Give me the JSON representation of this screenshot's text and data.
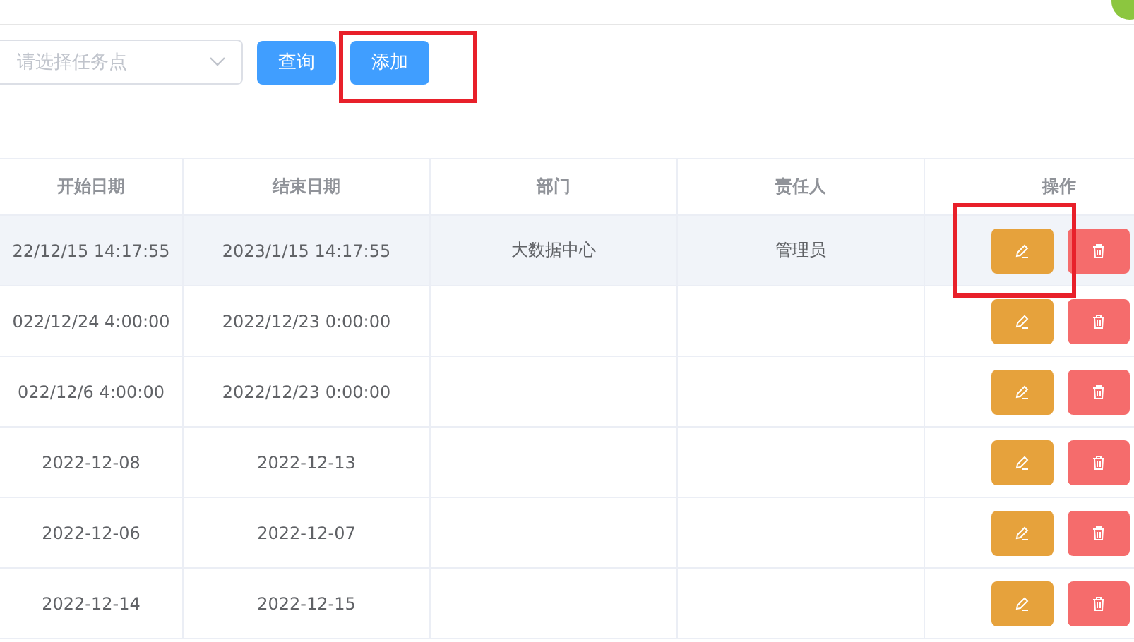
{
  "filter": {
    "placeholder": "请选择任务点"
  },
  "buttons": [
    {
      "label": "查询",
      "highlighted": false
    },
    {
      "label": "添加",
      "highlighted": true
    }
  ],
  "table": {
    "columns": [
      "开始日期",
      "结束日期",
      "部门",
      "责任人",
      "操作"
    ],
    "rows": [
      {
        "start": "22/12/15 14:17:55",
        "end": "2023/1/15 14:17:55",
        "department": "大数据中心",
        "owner": "管理员",
        "hovered": true,
        "edit_highlighted": true
      },
      {
        "start": "022/12/24 4:00:00",
        "end": "2022/12/23 0:00:00",
        "department": "",
        "owner": "",
        "hovered": false,
        "edit_highlighted": false
      },
      {
        "start": "022/12/6 4:00:00",
        "end": "2022/12/23 0:00:00",
        "department": "",
        "owner": "",
        "hovered": false,
        "edit_highlighted": false
      },
      {
        "start": "2022-12-08",
        "end": "2022-12-13",
        "department": "",
        "owner": "",
        "hovered": false,
        "edit_highlighted": false
      },
      {
        "start": "2022-12-06",
        "end": "2022-12-07",
        "department": "",
        "owner": "",
        "hovered": false,
        "edit_highlighted": false
      },
      {
        "start": "2022-12-14",
        "end": "2022-12-15",
        "department": "",
        "owner": "",
        "hovered": false,
        "edit_highlighted": false
      }
    ]
  }
}
